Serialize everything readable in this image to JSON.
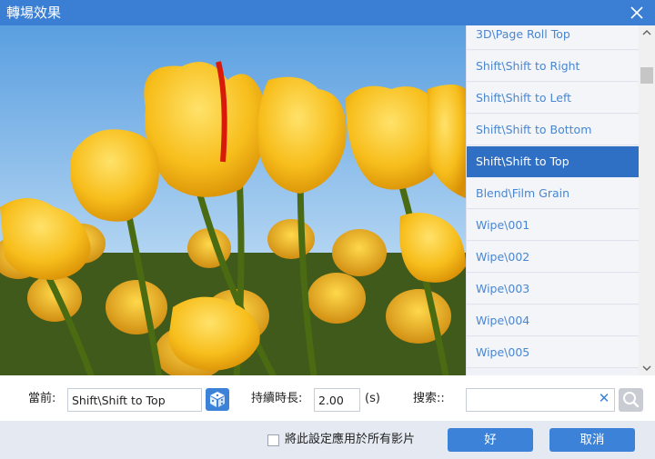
{
  "window": {
    "title": "轉場效果"
  },
  "effects": {
    "items": [
      "3D\\Page Roll Top",
      "Shift\\Shift to Right",
      "Shift\\Shift to Left",
      "Shift\\Shift to Bottom",
      "Shift\\Shift to Top",
      "Blend\\Film Grain",
      "Wipe\\001",
      "Wipe\\002",
      "Wipe\\003",
      "Wipe\\004",
      "Wipe\\005"
    ],
    "selected_index": 4
  },
  "controls": {
    "current_label": "當前:",
    "current_value": "Shift\\Shift to Top",
    "duration_label": "持續時長:",
    "duration_value": "2.00",
    "duration_unit": "(s)",
    "search_label": "搜索::",
    "search_value": ""
  },
  "footer": {
    "apply_all_label": "將此設定應用於所有影片",
    "apply_all_checked": false,
    "ok_label": "好",
    "cancel_label": "取消"
  },
  "colors": {
    "accent": "#3b82d8",
    "titlebar": "#3b7fd4",
    "selected": "#2f6fc4",
    "link_text": "#4a86d0"
  },
  "icons": [
    "close-icon",
    "dice-icon",
    "clear-icon",
    "search-icon",
    "scroll-up-icon",
    "scroll-down-icon"
  ]
}
